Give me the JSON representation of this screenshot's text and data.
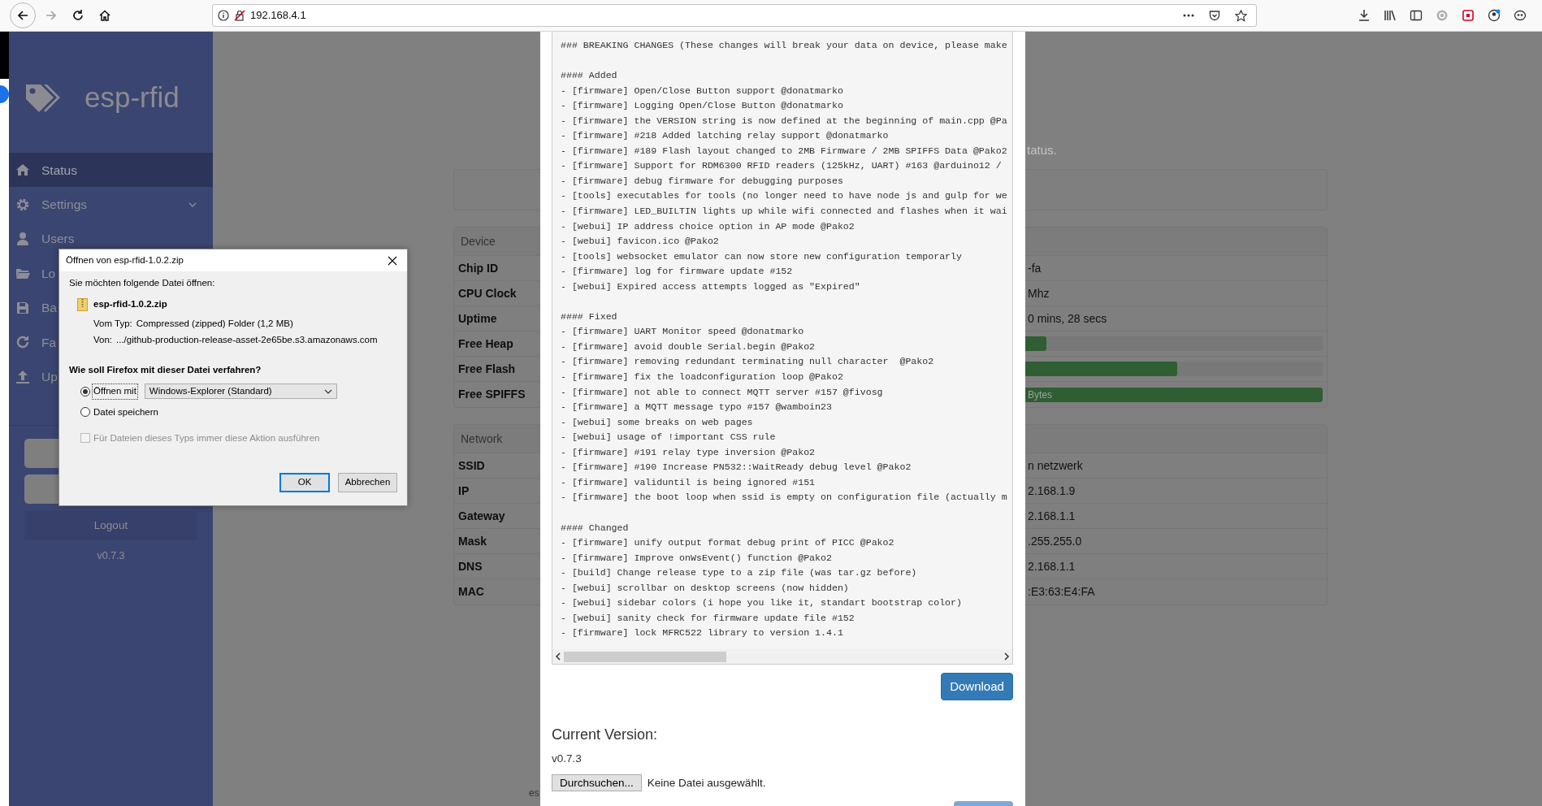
{
  "browser": {
    "url": "192.168.4.1"
  },
  "sidebar": {
    "brand": "esp-rfid",
    "items": [
      {
        "label": "Status",
        "selected": true
      },
      {
        "label": "Settings",
        "selected": false,
        "expandable": true
      },
      {
        "label": "Users",
        "selected": false
      },
      {
        "label": "Lo",
        "selected": false
      },
      {
        "label": "Ba",
        "selected": false
      },
      {
        "label": "Fa",
        "selected": false
      },
      {
        "label": "Up",
        "selected": false
      }
    ],
    "logout": "Logout",
    "version": "v0.7.3"
  },
  "status_page": {
    "subtitle": "tatus.",
    "device": {
      "title": "Device",
      "rows": [
        {
          "label": "Chip ID",
          "kind": "text",
          "value": "-fa"
        },
        {
          "label": "CPU Clock",
          "kind": "text",
          "value": "Mhz"
        },
        {
          "label": "Uptime",
          "kind": "text",
          "value": "0 mins, 28 secs"
        },
        {
          "label": "Free Heap",
          "kind": "bar",
          "level": 0.64
        },
        {
          "label": "Free Flash",
          "kind": "bar",
          "level": 0.81
        },
        {
          "label": "Free SPIFFS",
          "kind": "bar",
          "level": 1.0,
          "value": "Bytes"
        }
      ]
    },
    "network": {
      "title": "Network",
      "rows": [
        {
          "label": "SSID",
          "kind": "text",
          "value": "n netzwerk"
        },
        {
          "label": "IP",
          "kind": "text",
          "value": "2.168.1.9"
        },
        {
          "label": "Gateway",
          "kind": "text",
          "value": "2.168.1.1"
        },
        {
          "label": "Mask",
          "kind": "text",
          "value": ".255.255.0"
        },
        {
          "label": "DNS",
          "kind": "text",
          "value": "2.168.1.1"
        },
        {
          "label": "MAC",
          "kind": "text",
          "value": ":E3:63:E4:FA"
        }
      ]
    },
    "footer": "es"
  },
  "update_modal": {
    "changelog": {
      "intro": "### BREAKING CHANGES (These changes will break your data on device, please make",
      "sections": [
        {
          "heading": "#### Added",
          "items": [
            "- [firmware] Open/Close Button support @donatmarko",
            "- [firmware] Logging Open/Close Button @donatmarko",
            "- [firmware] the VERSION string is now defined at the beginning of main.cpp @Pa",
            "- [firmware] #218 Added latching relay support @donatmarko",
            "- [firmware] #189 Flash layout changed to 2MB Firmware / 2MB SPIFFS Data @Pako2",
            "- [firmware] Support for RDM6300 RFID readers (125kHz, UART) #163 @arduino12 /",
            "- [firmware] debug firmware for debugging purposes",
            "- [tools] executables for tools (no longer need to have node js and gulp for we",
            "- [firmware] LED_BUILTIN lights up while wifi connected and flashes when it wai",
            "- [webui] IP address choice option in AP mode @Pako2",
            "- [webui] favicon.ico @Pako2",
            "- [tools] websocket emulator can now store new configuration temporarly",
            "- [firmware] log for firmware update #152",
            "- [webui] Expired access attempts logged as \"Expired\""
          ]
        },
        {
          "heading": "#### Fixed",
          "items": [
            "- [firmware] UART Monitor speed @donatmarko",
            "- [firmware] avoid double Serial.begin @Pako2",
            "- [firmware] removing redundant terminating null character  @Pako2",
            "- [firmware] fix the loadconfiguration loop @Pako2",
            "- [firmware] not able to connect MQTT server #157 @fivosg",
            "- [firmware] a MQTT message typo #157 @wamboin23",
            "- [webui] some breaks on web pages",
            "- [webui] usage of !important CSS rule",
            "- [firmware] #191 relay type inversion @Pako2",
            "- [firmware] #190 Increase PN532::WaitReady debug level @Pako2",
            "- [firmware] validuntil is being ignored #151",
            "- [firmware] the boot loop when ssid is empty on configuration file (actually m"
          ]
        },
        {
          "heading": "#### Changed",
          "items": [
            "- [firmware] unify output format debug print of PICC @Pako2",
            "- [firmware] Improve onWsEvent() function @Pako2",
            "- [build] Change release type to a zip file (was tar.gz before)",
            "- [webui] scrollbar on desktop screens (now hidden)",
            "- [webui] sidebar colors (i hope you like it, standart bootstrap color)",
            "- [webui] sanity check for firmware update file #152",
            "- [firmware] lock MFRC522 library to version 1.4.1"
          ]
        }
      ]
    },
    "download": "Download",
    "current_version_title": "Current Version:",
    "current_version": "v0.7.3",
    "file_button": "Durchsuchen...",
    "file_status": "Keine Datei ausgewählt."
  },
  "dialog": {
    "title": "Öffnen von esp-rfid-1.0.2.zip",
    "intro": "Sie möchten folgende Datei öffnen:",
    "filename": "esp-rfid-1.0.2.zip",
    "type_label": "Vom Typ:",
    "type": "Compressed (zipped) Folder (1,2 MB)",
    "from_label": "Von:",
    "from": ".../github-production-release-asset-2e65be.s3.amazonaws.com",
    "question": "Wie soll Firefox mit dieser Datei verfahren?",
    "options": [
      {
        "label": "Öffnen mit",
        "selected": true,
        "app": "Windows-Explorer (Standard)"
      },
      {
        "label": "Datei speichern",
        "selected": false
      }
    ],
    "remember": {
      "label": "Für Dateien dieses Typs immer diese Aktion ausführen",
      "checked": false,
      "disabled": true
    },
    "buttons": [
      {
        "label": "OK",
        "default": true
      },
      {
        "label": "Abbrechen",
        "default": false
      }
    ]
  }
}
